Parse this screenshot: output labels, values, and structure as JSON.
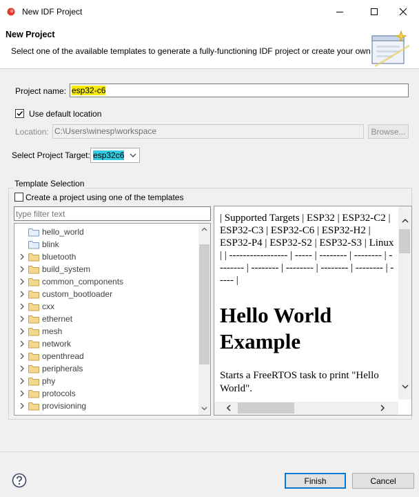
{
  "window": {
    "title": "New IDF Project",
    "controls": [
      "minimize-icon",
      "maximize-icon",
      "close-icon"
    ]
  },
  "banner": {
    "title": "New Project",
    "description": "Select one of the available templates to generate a fully-functioning IDF project or create your own"
  },
  "form": {
    "project_name_label": "Project name:",
    "project_name_value": "esp32-c6",
    "use_default_location_label": "Use default location",
    "use_default_location_checked": true,
    "location_label": "Location:",
    "location_value": "C:\\Users\\winesp\\workspace",
    "browse_label": "Browse...",
    "target_label": "Select Project Target:",
    "target_value": "esp32c6"
  },
  "templates": {
    "group_label": "Template Selection",
    "create_from_template_label": "Create a project using one of the templates",
    "create_from_template_checked": false,
    "filter_placeholder": "type filter text",
    "tree_items": [
      {
        "label": "hello_world",
        "expandable": false
      },
      {
        "label": "blink",
        "expandable": false
      },
      {
        "label": "bluetooth",
        "expandable": true
      },
      {
        "label": "build_system",
        "expandable": true
      },
      {
        "label": "common_components",
        "expandable": true
      },
      {
        "label": "custom_bootloader",
        "expandable": true
      },
      {
        "label": "cxx",
        "expandable": true
      },
      {
        "label": "ethernet",
        "expandable": true
      },
      {
        "label": "mesh",
        "expandable": true
      },
      {
        "label": "network",
        "expandable": true
      },
      {
        "label": "openthread",
        "expandable": true
      },
      {
        "label": "peripherals",
        "expandable": true
      },
      {
        "label": "phy",
        "expandable": true
      },
      {
        "label": "protocols",
        "expandable": true
      },
      {
        "label": "provisioning",
        "expandable": true
      }
    ],
    "preview": {
      "table_markdown": "| Supported Targets | ESP32 | ESP32-C2 | ESP32-C3 | ESP32-C6 | ESP32-H2 | ESP32-P4 | ESP32-S2 | ESP32-S3 | Linux | | ----------------- | ----- | -------- | -------- | -------- | -------- | -------- | -------- | -------- | ----- |",
      "heading": "Hello World Example",
      "paragraph": "Starts a FreeRTOS task to print \"Hello World\"."
    }
  },
  "footer": {
    "finish_label": "Finish",
    "cancel_label": "Cancel"
  },
  "colors": {
    "accent": "#0078d7",
    "highlight_name": "#f5e90c",
    "highlight_target": "#33cbe0",
    "folder": "#dcb67a"
  }
}
